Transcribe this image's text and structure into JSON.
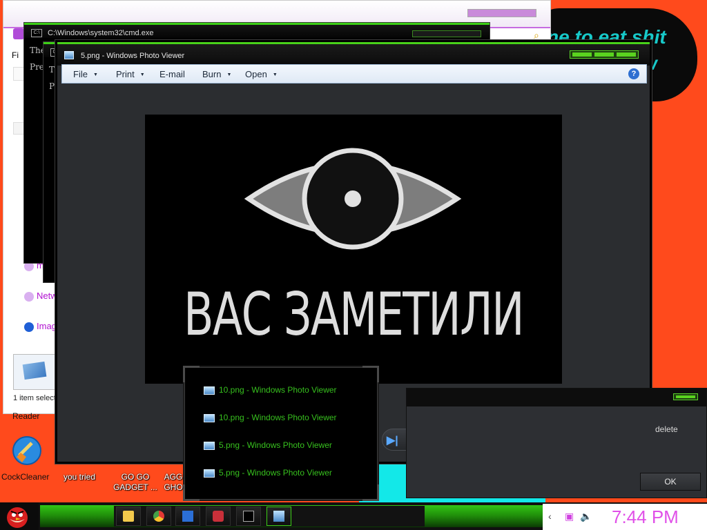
{
  "desktop": {
    "banner_line1": "ne to eat shit",
    "banner_line2": "w",
    "icons": [
      {
        "label": "Reader"
      },
      {
        "label": "CockCleaner"
      },
      {
        "label": "you tried"
      },
      {
        "label": "GO GO GADGET ..."
      },
      {
        "label": "AGG GHO"
      }
    ]
  },
  "explorer": {
    "menu_label": "Fi",
    "nav_items": [
      "m",
      "Netw",
      "Imag"
    ],
    "status": "1 item selecte"
  },
  "cmd1": {
    "title": "C:\\Windows\\system32\\cmd.exe",
    "lines": [
      "The",
      "Pre"
    ]
  },
  "cmd2": {
    "lines": [
      "T",
      "P"
    ]
  },
  "photo_viewer": {
    "title": "5.png - Windows Photo Viewer",
    "menu": [
      {
        "label": "File",
        "has_caret": true
      },
      {
        "label": "Print",
        "has_caret": true
      },
      {
        "label": "E-mail",
        "has_caret": false
      },
      {
        "label": "Burn",
        "has_caret": true
      },
      {
        "label": "Open",
        "has_caret": true
      }
    ],
    "image_caption": "ВАС ЗАМЕТИЛИ",
    "help_glyph": "?"
  },
  "taskbar_popup": {
    "items": [
      "10.png - Windows Photo Viewer",
      "10.png - Windows Photo Viewer",
      "5.png - Windows Photo Viewer",
      "5.png - Windows Photo Viewer"
    ]
  },
  "dialog": {
    "message": "delete",
    "ok_label": "OK"
  },
  "taskbar": {
    "clock": "7:44 PM"
  },
  "colors": {
    "accent_green": "#3ccf16",
    "clock_magenta": "#e050e8",
    "desktop_orange": "#ff4a1c"
  }
}
